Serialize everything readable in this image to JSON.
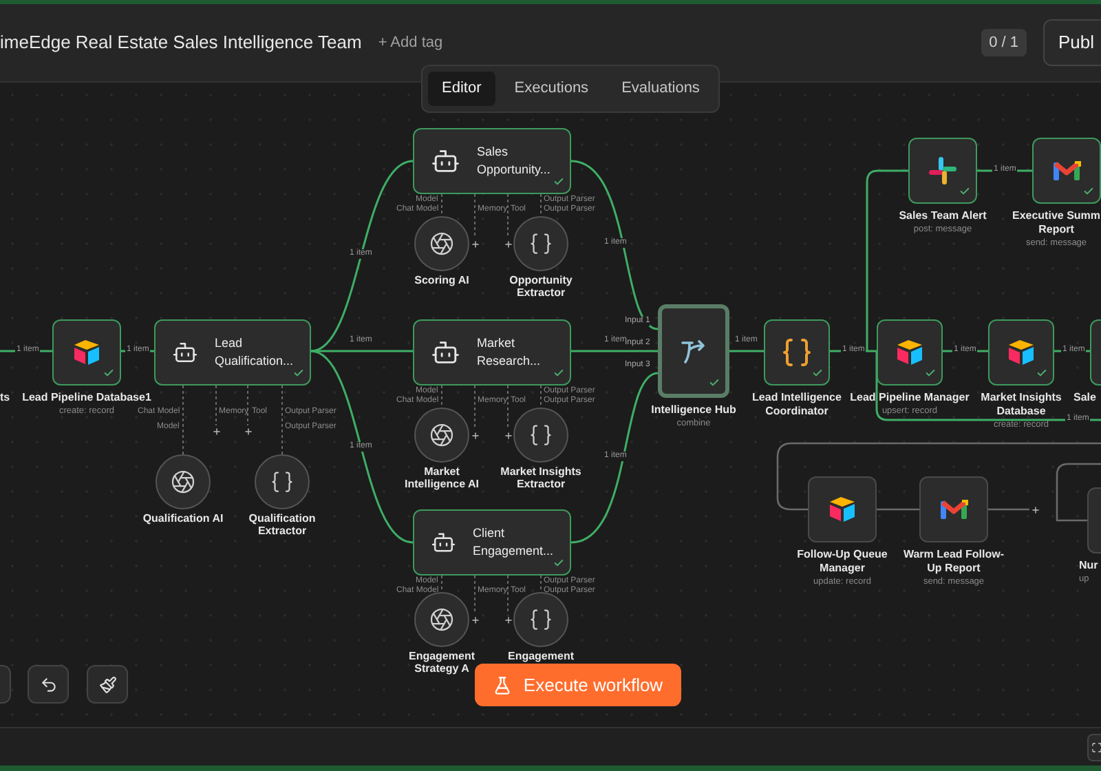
{
  "workflow": {
    "title": "imeEdge Real Estate Sales Intelligence Team",
    "add_tag": "+ Add tag",
    "counter": "0 / 1",
    "publish_button": "Publ"
  },
  "tabs": [
    {
      "label": "Editor",
      "selected": true
    },
    {
      "label": "Executions",
      "selected": false
    },
    {
      "label": "Evaluations",
      "selected": false
    }
  ],
  "nodes": [
    {
      "kind": "action",
      "label": "ts"
    },
    {
      "kind": "action",
      "label": "Lead Pipeline Database1",
      "subtitle": "create: record",
      "executed": true
    },
    {
      "kind": "agent",
      "label": "Lead Qualification...",
      "executed": true,
      "ports": [
        "Chat Model",
        "Memory",
        "Tool",
        "Output Parser"
      ],
      "sub_ports": [
        "Model",
        "Output Parser"
      ]
    },
    {
      "kind": "agent",
      "label": "Sales Opportunity...",
      "executed": true,
      "ports": [
        "Chat Model",
        "Memory",
        "Tool",
        "Output Parser"
      ],
      "sub_ports": [
        "Model",
        "Output Parser"
      ]
    },
    {
      "kind": "agent",
      "label": "Market Research...",
      "executed": true,
      "ports": [
        "Chat Model",
        "Memory",
        "Tool",
        "Output Parser"
      ],
      "sub_ports": [
        "Model",
        "Output Parser"
      ]
    },
    {
      "kind": "agent",
      "label": "Client Engagement...",
      "executed": true,
      "ports": [
        "Chat Model",
        "Memory",
        "Tool",
        "Output Parser"
      ],
      "sub_ports": [
        "Model",
        "Output Parser"
      ]
    },
    {
      "kind": "merge",
      "label": "Intelligence Hub",
      "subtitle": "combine",
      "executed": true,
      "inputs": [
        "Input 1",
        "Input 2",
        "Input 3"
      ]
    },
    {
      "kind": "action",
      "label": "Lead Intelligence Coordinator",
      "executed": true
    },
    {
      "kind": "action",
      "label": "Lead Pipeline Manager",
      "subtitle": "upsert: record",
      "executed": true
    },
    {
      "kind": "action",
      "label": "Market Insights Database",
      "subtitle": "create: record",
      "executed": true
    },
    {
      "kind": "action",
      "label": "Sale",
      "executed": true
    },
    {
      "kind": "action",
      "label": "Sales Team Alert",
      "subtitle": "post: message",
      "executed": true
    },
    {
      "kind": "action",
      "label": "Executive Summ Report",
      "subtitle": "send: message",
      "executed": true
    },
    {
      "kind": "action",
      "label": "Follow-Up Queue Manager",
      "subtitle": "update: record",
      "executed": false
    },
    {
      "kind": "action",
      "label": "Warm Lead Follow-Up Report",
      "subtitle": "send: message",
      "executed": false
    },
    {
      "kind": "action",
      "label": "Nur",
      "subtitle": "up",
      "executed": false
    }
  ],
  "sub_nodes": [
    {
      "kind": "model",
      "label": "Qualification AI"
    },
    {
      "kind": "parser",
      "label": "Qualification Extractor"
    },
    {
      "kind": "model",
      "label": "Scoring AI"
    },
    {
      "kind": "parser",
      "label": "Opportunity Extractor"
    },
    {
      "kind": "model",
      "label": "Market Intelligence AI"
    },
    {
      "kind": "parser",
      "label": "Market Insights Extractor"
    },
    {
      "kind": "model",
      "label": "Engagement Strategy A"
    },
    {
      "kind": "parser",
      "label": "Engagement"
    }
  ],
  "edges": [
    {
      "label": "1 item"
    },
    {
      "label": "1 item"
    },
    {
      "label": "1 item"
    },
    {
      "label": "1 item"
    },
    {
      "label": "1 item"
    },
    {
      "label": "1 item"
    },
    {
      "label": "1 item"
    },
    {
      "label": "1 item"
    },
    {
      "label": "1 item"
    },
    {
      "label": "1 item"
    },
    {
      "label": "1 item"
    },
    {
      "label": "1 item"
    },
    {
      "label": "1 item"
    },
    {
      "label": "1 item"
    }
  ],
  "execute_button": "Execute workflow"
}
